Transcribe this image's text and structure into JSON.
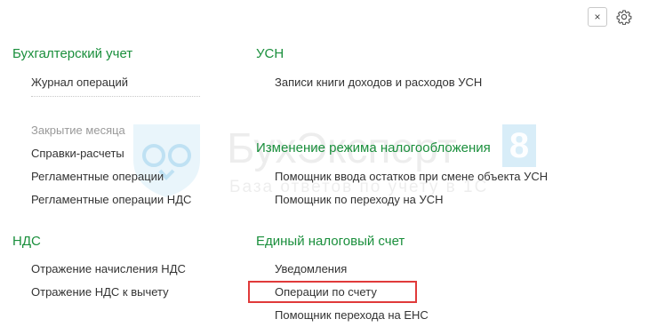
{
  "toolbar": {
    "close_glyph": "×",
    "close_icon": "close-icon",
    "settings_icon": "gear-icon"
  },
  "watermark": {
    "brand": "БухЭксперт",
    "badge": "8",
    "tagline": "База ответов по учету в 1С",
    "logo_icon": "owl-shield-icon"
  },
  "left_column": {
    "accounting": {
      "title": "Бухгалтерский учет",
      "items": [
        "Журнал операций"
      ],
      "secondary_items": [
        "Закрытие месяца",
        "Справки-расчеты",
        "Регламентные операции",
        "Регламентные операции НДС"
      ]
    },
    "vat": {
      "title": "НДС",
      "items": [
        "Отражение начисления НДС",
        "Отражение НДС к вычету"
      ]
    }
  },
  "right_column": {
    "usn": {
      "title": "УСН",
      "items": [
        "Записи книги доходов и расходов УСН"
      ]
    },
    "regime_change": {
      "title": "Изменение режима налогообложения",
      "items": [
        "Помощник ввода остатков при смене объекта УСН",
        "Помощник по переходу на УСН"
      ]
    },
    "unified_tax_account": {
      "title": "Единый налоговый счет",
      "items": [
        "Уведомления",
        "Операции по счету",
        "Помощник перехода на ЕНС"
      ]
    }
  },
  "colors": {
    "section_title": "#1a8f3c",
    "highlight": "#e03a3a",
    "text": "#333333"
  }
}
